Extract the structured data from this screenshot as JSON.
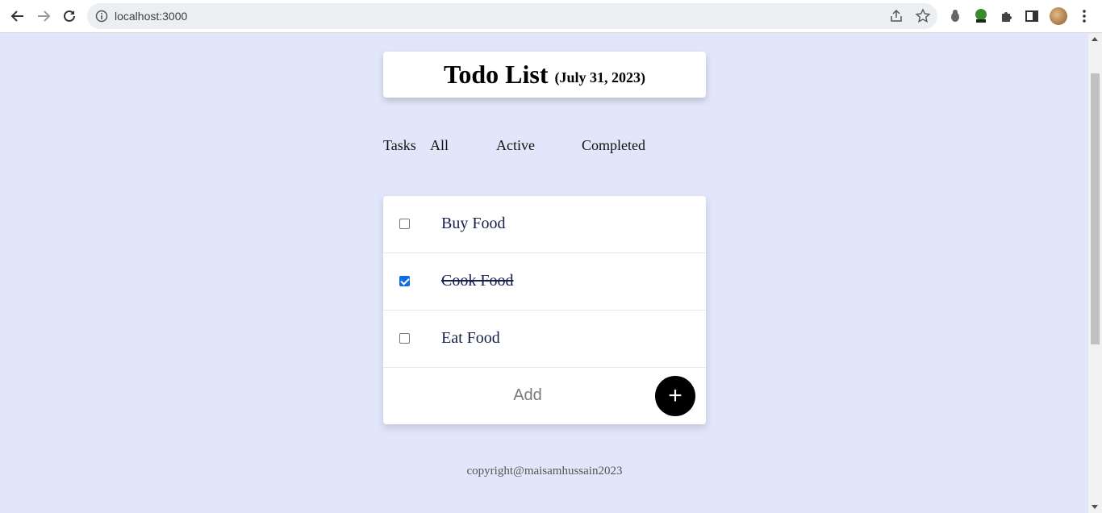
{
  "browser": {
    "url": "localhost:3000"
  },
  "header": {
    "title": "Todo List",
    "date": "(July 31, 2023)"
  },
  "tabs": {
    "lead": "Tasks",
    "items": [
      "All",
      "Active",
      "Completed"
    ]
  },
  "tasks": [
    {
      "label": "Buy Food",
      "completed": false
    },
    {
      "label": "Cook Food",
      "completed": true
    },
    {
      "label": "Eat Food",
      "completed": false
    }
  ],
  "add": {
    "placeholder": "Add",
    "button_label": "+"
  },
  "footer": {
    "text": "copyright@maisamhussain2023"
  },
  "colors": {
    "page_background": "#e2e6fa",
    "checkbox_accent": "#0b6ee8",
    "add_button": "#000000"
  }
}
